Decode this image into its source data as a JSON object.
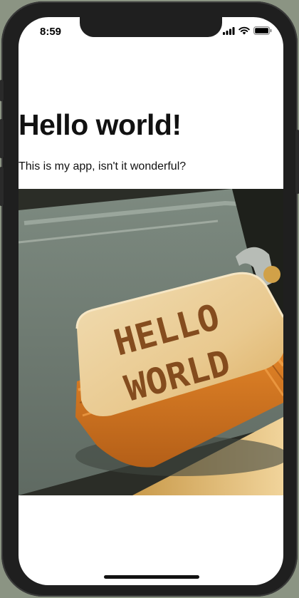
{
  "status_bar": {
    "time": "8:59",
    "icons": [
      "signal-icon",
      "wifi-icon",
      "battery-icon"
    ]
  },
  "content": {
    "headline": "Hello world!",
    "subtitle": "This is my app, isn't it wonderful?",
    "image": {
      "subject": "toast-with-hello-world-photo",
      "burned_text": "HELLO WORLD"
    }
  },
  "colors": {
    "screen_bg": "#ffffff",
    "text": "#111111",
    "frame": "#1f1f1f"
  }
}
